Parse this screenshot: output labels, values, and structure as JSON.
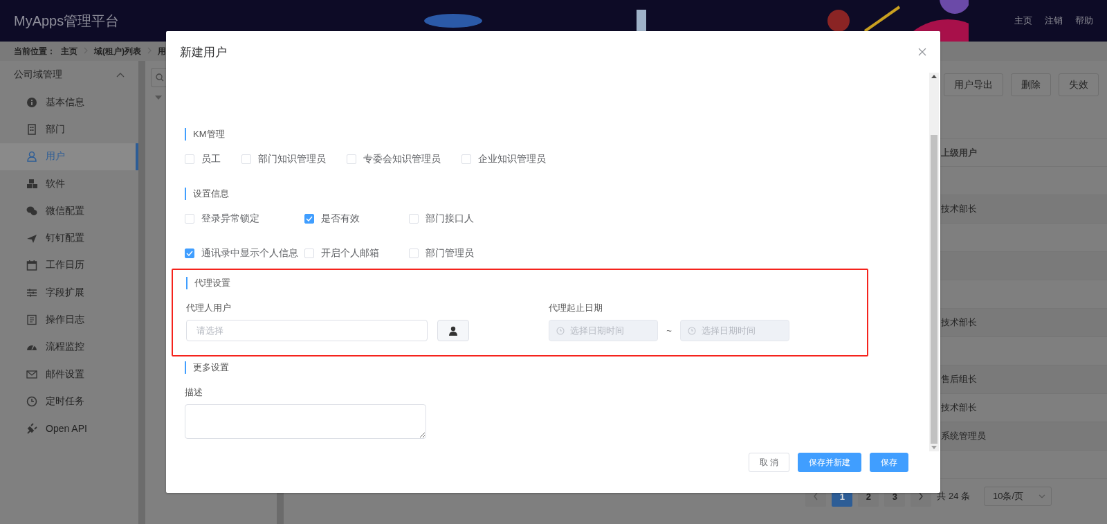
{
  "header": {
    "title": "MyApps管理平台",
    "links": [
      "主页",
      "注销",
      "帮助"
    ]
  },
  "breadcrumb": {
    "label": "当前位置：",
    "items": [
      "主页",
      "域(租户)列表",
      "用"
    ]
  },
  "sidebar": {
    "title": "公司域管理",
    "expanded": true,
    "items": [
      {
        "label": "基本信息",
        "selected": false
      },
      {
        "label": "部门",
        "selected": false
      },
      {
        "label": "用户",
        "selected": true
      },
      {
        "label": "软件",
        "selected": false
      },
      {
        "label": "微信配置",
        "selected": false
      },
      {
        "label": "钉钉配置",
        "selected": false
      },
      {
        "label": "工作日历",
        "selected": false
      },
      {
        "label": "字段扩展",
        "selected": false
      },
      {
        "label": "操作日志",
        "selected": false
      },
      {
        "label": "流程监控",
        "selected": false
      },
      {
        "label": "邮件设置",
        "selected": false
      },
      {
        "label": "定时任务",
        "selected": false
      },
      {
        "label": "Open API",
        "selected": false
      }
    ]
  },
  "toolbar": {
    "buttons": [
      "用户导出",
      "删除",
      "失效"
    ]
  },
  "table": {
    "columns": [
      "上级用户"
    ],
    "rows": [
      {},
      {
        "superior": "技术部长"
      },
      {},
      {},
      {},
      {
        "superior": "技术部长"
      },
      {},
      {
        "superior": "售后组长"
      },
      {
        "superior": "技术部长"
      },
      {
        "superior": "系统管理员"
      },
      {}
    ]
  },
  "pagination": {
    "pages": [
      {
        "label": "1",
        "selected": true
      },
      {
        "label": "2",
        "selected": false
      },
      {
        "label": "3",
        "selected": false
      }
    ],
    "total": "共 24 条",
    "page_size": "10条/页"
  },
  "dialog": {
    "title": "新建用户",
    "sections": [
      {
        "kind": "inline",
        "title": "KM管理",
        "rows": [
          [
            {
              "label": "员工",
              "checked": false
            },
            {
              "label": "部门知识管理员",
              "checked": false
            },
            {
              "label": "专委会知识管理员",
              "checked": false
            },
            {
              "label": "企业知识管理员",
              "checked": false
            }
          ]
        ]
      },
      {
        "kind": "grid",
        "title": "设置信息",
        "rows": [
          [
            {
              "label": "登录异常锁定",
              "checked": false
            },
            {
              "label": "是否有效",
              "checked": true
            },
            {
              "label": "部门接口人",
              "checked": false
            }
          ],
          [
            {
              "label": "通讯录中显示个人信息",
              "checked": true
            },
            {
              "label": "开启个人邮箱",
              "checked": false
            },
            {
              "label": "部门管理员",
              "checked": false
            }
          ]
        ]
      },
      {
        "kind": "proxy",
        "title": "代理设置",
        "highlighted": true,
        "user_label": "代理人用户",
        "user_placeholder": "请选择",
        "date_label": "代理起止日期",
        "start_placeholder": "选择日期时间",
        "separator": "~",
        "end_placeholder": "选择日期时间",
        "dates_disabled": true
      },
      {
        "kind": "more",
        "title": "更多设置",
        "field_label": "描述"
      }
    ],
    "buttons": [
      {
        "label": "取 消",
        "kind": "default"
      },
      {
        "label": "保存并新建",
        "kind": "primary"
      },
      {
        "label": "保存",
        "kind": "primary"
      }
    ]
  }
}
